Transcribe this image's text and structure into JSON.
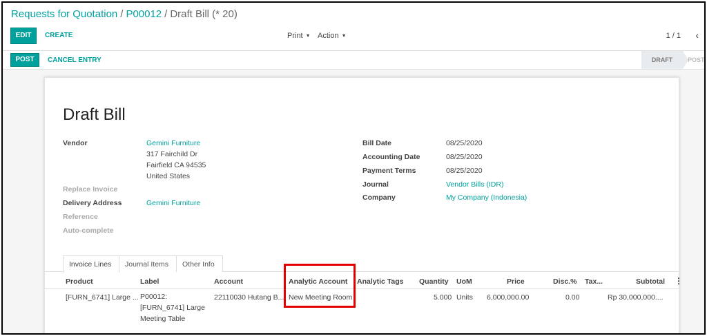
{
  "breadcrumb": {
    "parent": "Requests for Quotation",
    "order": "P00012",
    "current": "Draft Bill (* 20)"
  },
  "control": {
    "edit_label": "EDIT",
    "create_label": "CREATE",
    "print_label": "Print",
    "action_label": "Action",
    "pager": "1 / 1"
  },
  "statusbar": {
    "post_label": "POST",
    "cancel_label": "CANCEL ENTRY",
    "stages": [
      "DRAFT",
      "POSTED"
    ]
  },
  "form": {
    "title": "Draft Bill",
    "left": {
      "vendor_label": "Vendor",
      "vendor_name": "Gemini Furniture",
      "vendor_address": [
        "317 Fairchild Dr",
        "Fairfield CA 94535",
        "United States"
      ],
      "replace_invoice_label": "Replace Invoice",
      "delivery_address_label": "Delivery Address",
      "delivery_address_value": "Gemini Furniture",
      "reference_label": "Reference",
      "autocomplete_label": "Auto-complete"
    },
    "right": {
      "bill_date_label": "Bill Date",
      "bill_date_value": "08/25/2020",
      "accounting_date_label": "Accounting Date",
      "accounting_date_value": "08/25/2020",
      "payment_terms_label": "Payment Terms",
      "payment_terms_value": "08/25/2020",
      "journal_label": "Journal",
      "journal_value": "Vendor Bills (IDR)",
      "company_label": "Company",
      "company_value": "My Company (Indonesia)"
    }
  },
  "tabs": [
    "Invoice Lines",
    "Journal Items",
    "Other Info"
  ],
  "table": {
    "columns": [
      "Product",
      "Label",
      "Account",
      "Analytic Account",
      "Analytic Tags",
      "Quantity",
      "UoM",
      "Price",
      "Disc.%",
      "Tax...",
      "Subtotal"
    ],
    "rows": [
      {
        "product": "[FURN_6741] Large ...",
        "label": "P00012: [FURN_6741] Large Meeting Table",
        "account": "22110030 Hutang B...",
        "analytic_account": "New Meeting Room",
        "analytic_tags": "",
        "quantity": "5.000",
        "uom": "Units",
        "price": "6,000,000.00",
        "discount": "0.00",
        "tax": "",
        "subtotal": "Rp 30,000,000...."
      }
    ]
  },
  "colors": {
    "accent": "#00a09d",
    "highlight": "#e30000"
  }
}
